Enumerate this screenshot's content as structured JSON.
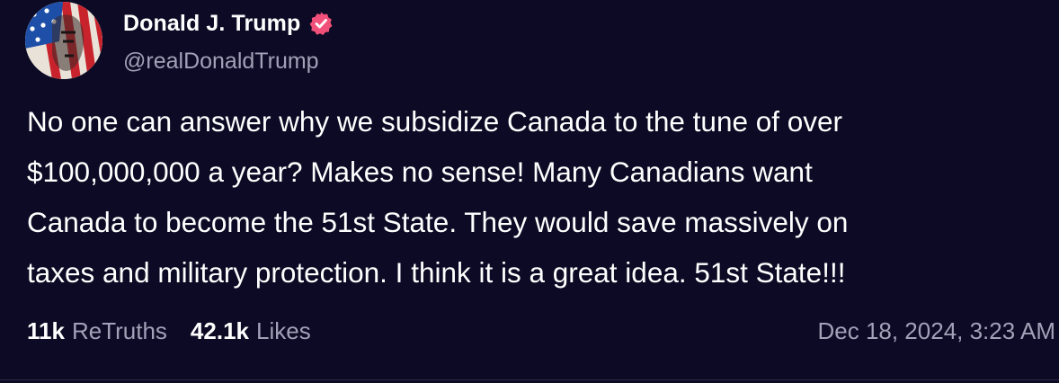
{
  "author": {
    "display_name": "Donald J. Trump",
    "handle": "@realDonaldTrump",
    "verified_icon": "verified-badge-icon",
    "avatar_icon": "avatar-flag-portrait"
  },
  "post": {
    "text": "No one can answer why we subsidize Canada to the tune of over\n$100,000,000 a year? Makes no sense! Many Canadians want\nCanada to become the 51st State. They would save massively on\ntaxes and military protection. I think it is a great idea. 51st State!!!"
  },
  "stats": {
    "retruths_count": "11k",
    "retruths_label": "ReTruths",
    "likes_count": "42.1k",
    "likes_label": "Likes",
    "timestamp": "Dec 18, 2024, 3:23 AM"
  },
  "colors": {
    "background": "#0c0a24",
    "text": "#ffffff",
    "muted": "#a3a1b8",
    "verified": "#f0507a"
  }
}
